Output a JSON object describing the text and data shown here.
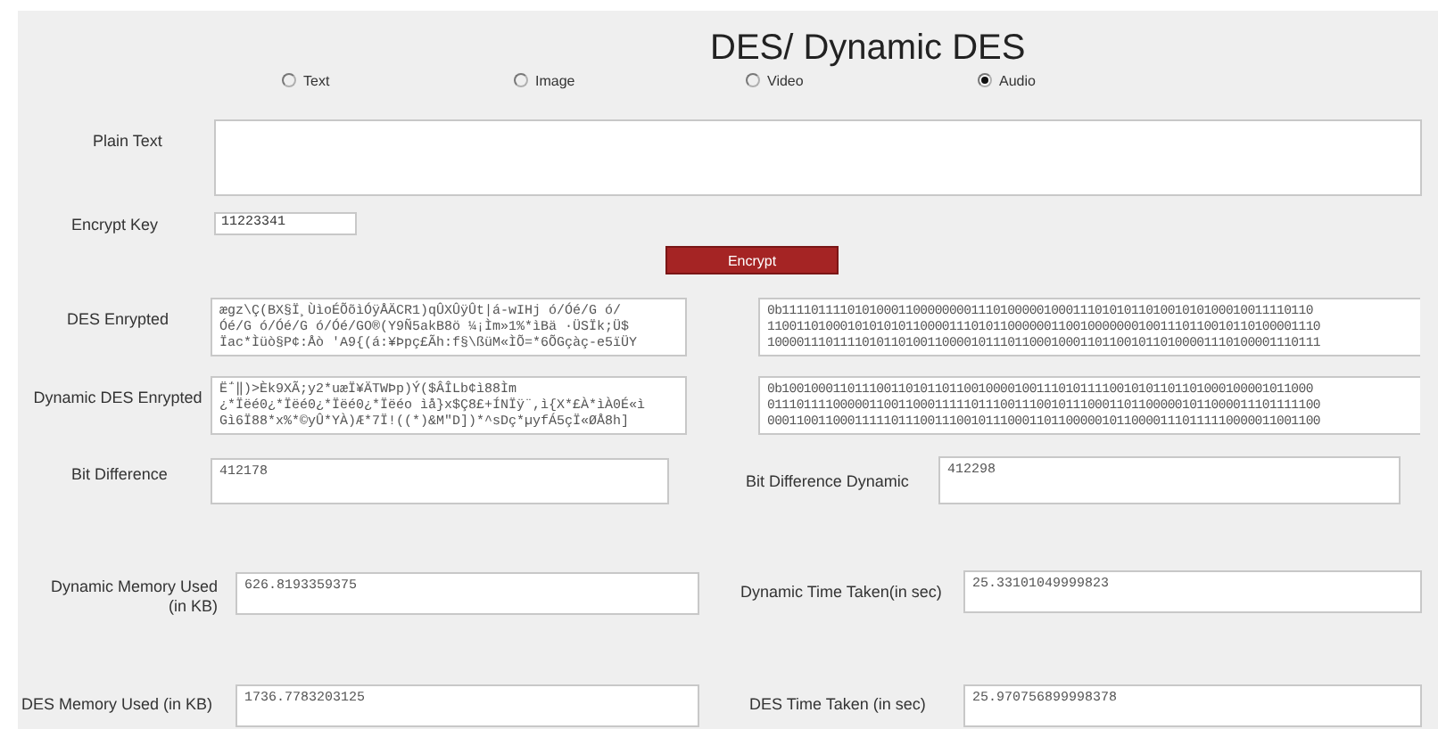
{
  "title": "DES/ Dynamic DES",
  "media_options": [
    {
      "label": "Text",
      "selected": false
    },
    {
      "label": "Image",
      "selected": false
    },
    {
      "label": "Video",
      "selected": false
    },
    {
      "label": "Audio",
      "selected": true
    }
  ],
  "plain_text": {
    "label": "Plain Text"
  },
  "encrypt_key": {
    "label": "Encrypt Key",
    "value": "11223341"
  },
  "encrypt_button": "Encrypt",
  "des_encrypted": {
    "label": "DES Enrypted",
    "text_lines": [
      "ægz\\Ç(BX§Ï¸ÙìoÉÕõìÓÿÅÄCR1)qÛXÛÿÛt|á-wIHj ó/Óé/G ó/",
      "Óé/G ó/Óé/G ó/Óé/GO®(Y9Ñ5akB8ö ¼¡Ìm»1%*ìBä ·ÜSÏk;Ü$",
      "Ïac*Ìüò§P¢:Åò 'A9{(á:¥Þpç£Ãh:f§\\ßüM«ÌÕ=*6ÕGçàç-e5ïÜY"
    ],
    "binary_lines": [
      "0b1111011110101000110000000011101000001000111010101101001010100010011110110",
      "1100110100010101010110000111010110000001100100000001001110110010110100001110",
      "1000011101111010110100110000101110110001000110110010110100001110100001110111"
    ]
  },
  "dynamic_des_encrypted": {
    "label": "Dynamic DES Enrypted",
    "text_lines": [
      "Ë΅‖)>Èk9XÃ;y2*uæÏ¥ÄTWÞp)Ý($ÂÎLb¢ì88Ìm",
      "¿*Ïëé0¿*Ïëé0¿*Ïëé0¿*Ïëéo ìå}x$Ç8£+ÍNÏÿ¨,ì{X*£À*ìÀ0É«ì",
      "Gì6Ï88*x%*©yÛ*YÀ)Æ*7Ï!((*)&M\"D])*^sDç*µyfÁ5çÏ«ØÅ8h]"
    ],
    "binary_lines": [
      "0b1001000110111001101011011001000010011101011110010101101101000100001011000",
      "0111011110000011001100011111011100111001011100011011000001011000011101111100",
      "0001100110001111101110011100101110001101100000101100001110111110000011001100"
    ]
  },
  "bit_difference": {
    "label": "Bit Difference",
    "value": "412178"
  },
  "bit_difference_dynamic": {
    "label": "Bit Difference Dynamic",
    "value": "412298"
  },
  "dynamic_memory": {
    "label": "Dynamic Memory Used (in KB)",
    "value": "626.8193359375"
  },
  "dynamic_time": {
    "label": "Dynamic Time Taken(in sec)",
    "value": "25.33101049999823"
  },
  "des_memory": {
    "label": "DES Memory Used (in KB)",
    "value": "1736.7783203125"
  },
  "des_time": {
    "label": "DES Time Taken (in sec)",
    "value": "25.970756899998378"
  }
}
